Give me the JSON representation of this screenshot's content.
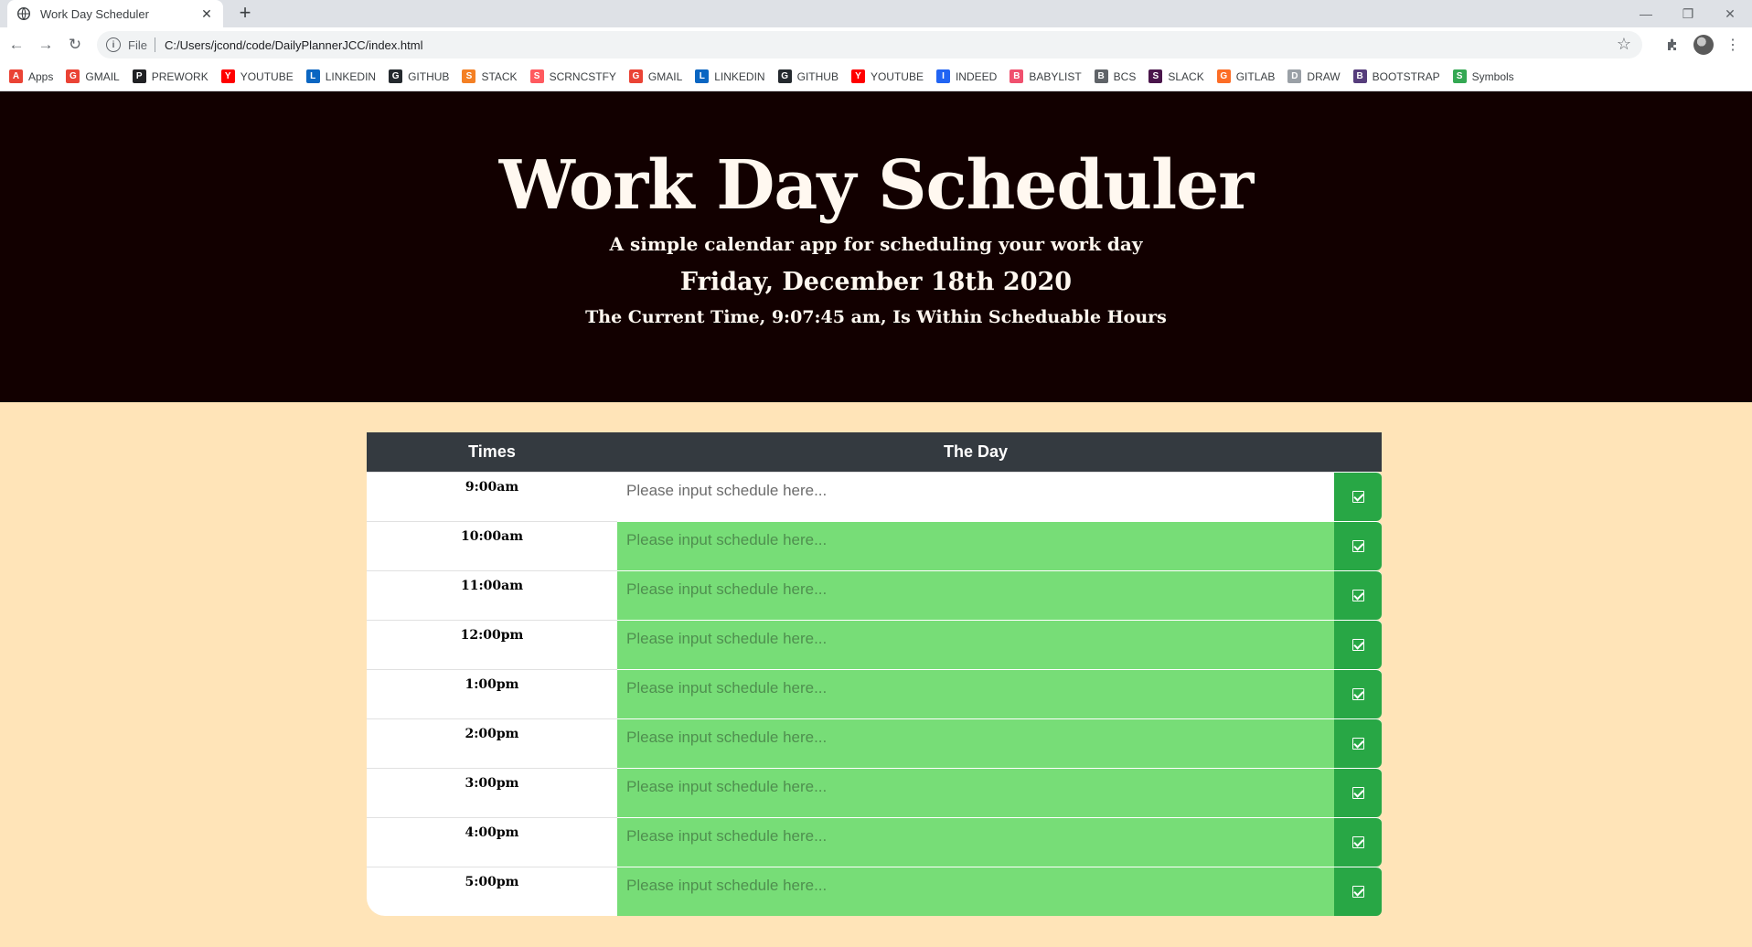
{
  "browser": {
    "tab_title": "Work Day Scheduler",
    "new_tab_label": "+",
    "url_scheme": "File",
    "url": "C:/Users/jcond/code/DailyPlannerJCC/index.html"
  },
  "bookmarks": [
    {
      "label": "Apps",
      "icon": "apps-grid-icon",
      "color": "#ea4335"
    },
    {
      "label": "GMAIL",
      "icon": "gmail-icon",
      "color": "#ea4335"
    },
    {
      "label": "PREWORK",
      "icon": "book-icon",
      "color": "#202124"
    },
    {
      "label": "YOUTUBE",
      "icon": "youtube-icon",
      "color": "#ff0000"
    },
    {
      "label": "LINKEDIN",
      "icon": "linkedin-icon",
      "color": "#0a66c2"
    },
    {
      "label": "GITHUB",
      "icon": "github-icon",
      "color": "#24292e"
    },
    {
      "label": "STACK",
      "icon": "stackoverflow-icon",
      "color": "#f48024"
    },
    {
      "label": "SCRNCSTFY",
      "icon": "screencastify-icon",
      "color": "#ff5a5f"
    },
    {
      "label": "GMAIL",
      "icon": "gmail-icon",
      "color": "#ea4335"
    },
    {
      "label": "LINKEDIN",
      "icon": "linkedin-icon",
      "color": "#0a66c2"
    },
    {
      "label": "GITHUB",
      "icon": "github-icon",
      "color": "#24292e"
    },
    {
      "label": "YOUTUBE",
      "icon": "youtube-icon",
      "color": "#ff0000"
    },
    {
      "label": "INDEED",
      "icon": "indeed-icon",
      "color": "#2164f3"
    },
    {
      "label": "BABYLIST",
      "icon": "heart-icon",
      "color": "#f0506e"
    },
    {
      "label": "BCS",
      "icon": "globe-icon",
      "color": "#5f6368"
    },
    {
      "label": "SLACK",
      "icon": "slack-icon",
      "color": "#4a154b"
    },
    {
      "label": "GITLAB",
      "icon": "gitlab-icon",
      "color": "#fc6d26"
    },
    {
      "label": "DRAW",
      "icon": "pen-icon",
      "color": "#9aa0a6"
    },
    {
      "label": "BOOTSTRAP",
      "icon": "bootstrap-icon",
      "color": "#563d7c"
    },
    {
      "label": "Symbols",
      "icon": "symbols-icon",
      "color": "#34a853"
    }
  ],
  "header": {
    "title": "Work Day Scheduler",
    "lead": "A simple calendar app for scheduling your work day",
    "date": "Friday, December 18th 2020",
    "time_status": "The Current Time, 9:07:45 am, Is Within Scheduable Hours"
  },
  "planner": {
    "col_times": "Times",
    "col_day": "The Day",
    "placeholder": "Please input schedule here...",
    "rows": [
      {
        "hour": "9:00am",
        "state": "present"
      },
      {
        "hour": "10:00am",
        "state": "future"
      },
      {
        "hour": "11:00am",
        "state": "future"
      },
      {
        "hour": "12:00pm",
        "state": "future"
      },
      {
        "hour": "1:00pm",
        "state": "future"
      },
      {
        "hour": "2:00pm",
        "state": "future"
      },
      {
        "hour": "3:00pm",
        "state": "future"
      },
      {
        "hour": "4:00pm",
        "state": "future"
      },
      {
        "hour": "5:00pm",
        "state": "future"
      }
    ]
  },
  "colors": {
    "jumbotron_bg": "#120000",
    "page_bg": "#ffe4b8",
    "future": "#77dd77",
    "present": "#ffffff",
    "save_button": "#28a745",
    "table_header": "#343a40"
  }
}
